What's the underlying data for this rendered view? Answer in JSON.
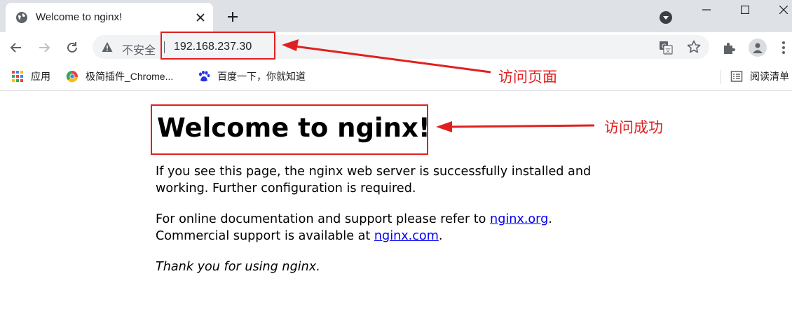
{
  "tab": {
    "title": "Welcome to nginx!"
  },
  "omnibox": {
    "security_label": "不安全",
    "url": "192.168.237.30"
  },
  "bookmarks": {
    "items": [
      {
        "label": "应用",
        "icon": "apps-grid-icon"
      },
      {
        "label": "极简插件_Chrome...",
        "icon": "chrome-icon"
      },
      {
        "label": "百度一下，你就知道",
        "icon": "baidu-paw-icon"
      }
    ],
    "reading_list": "阅读清单"
  },
  "page": {
    "heading": "Welcome to nginx!",
    "p1": "If you see this page, the nginx web server is successfully installed and working. Further configuration is required.",
    "p2_before": "For online documentation and support please refer to ",
    "p2_link1": "nginx.org",
    "p2_mid": ".",
    "p2_line2": "Commercial support is available at ",
    "p2_link2": "nginx.com",
    "p2_end": ".",
    "p3": "Thank you for using nginx."
  },
  "annotations": {
    "url_label": "访问页面",
    "heading_label": "访问成功",
    "color": "#e02020"
  }
}
